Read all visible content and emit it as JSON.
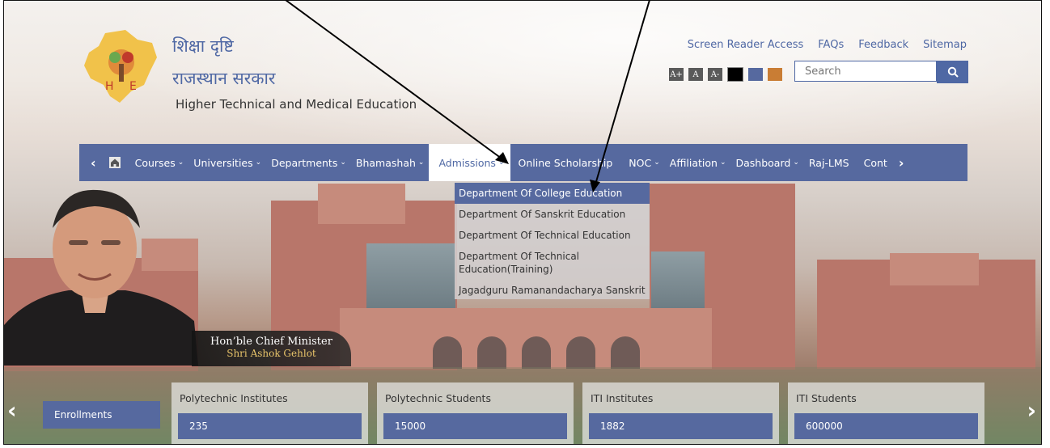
{
  "brand": {
    "title_hindi": "शिक्षा दृष्टि",
    "subtitle_hindi": "राजस्थान सरकार",
    "department": "Higher Technical and Medical Education"
  },
  "top_links": [
    "Screen Reader Access",
    "FAQs",
    "Feedback",
    "Sitemap"
  ],
  "font_controls": [
    "A+",
    "A",
    "A-"
  ],
  "theme_colors": [
    "#000000",
    "#56699f",
    "#c97d34"
  ],
  "search": {
    "placeholder": "Search"
  },
  "nav": {
    "prev_icon": "chevron-left",
    "home_icon": "home",
    "items": [
      {
        "label": "Courses",
        "has_dropdown": true
      },
      {
        "label": "Universities",
        "has_dropdown": true
      },
      {
        "label": "Departments",
        "has_dropdown": true
      },
      {
        "label": "Bhamashah",
        "has_dropdown": true
      },
      {
        "label": "Admissions",
        "has_dropdown": true,
        "active": true
      },
      {
        "label": "Online Scholarship",
        "has_dropdown": false
      },
      {
        "label": "NOC",
        "has_dropdown": true
      },
      {
        "label": "Affiliation",
        "has_dropdown": true
      },
      {
        "label": "Dashboard",
        "has_dropdown": true
      },
      {
        "label": "Raj-LMS",
        "has_dropdown": false
      },
      {
        "label": "Cont",
        "has_dropdown": false
      }
    ],
    "next_icon": "chevron-right"
  },
  "admissions_dropdown": [
    "Department Of College Education",
    "Department Of Sanskrit Education",
    "Department Of Technical Education",
    "Department Of Technical Education(Training)",
    "Jagadguru Ramanandacharya Sanskrit"
  ],
  "caption": {
    "line1": "Hon’ble Chief Minister",
    "line2": "Shri Ashok Gehlot"
  },
  "stats": {
    "enrollments_label": "Enrollments",
    "cards": [
      {
        "label": "Polytechnic Institutes",
        "value": "235"
      },
      {
        "label": "Polytechnic Students",
        "value": "15000"
      },
      {
        "label": "ITI Institutes",
        "value": "1882"
      },
      {
        "label": "ITI Students",
        "value": "600000"
      }
    ]
  },
  "colors": {
    "accent": "#56699f",
    "link": "#4f68a4"
  }
}
